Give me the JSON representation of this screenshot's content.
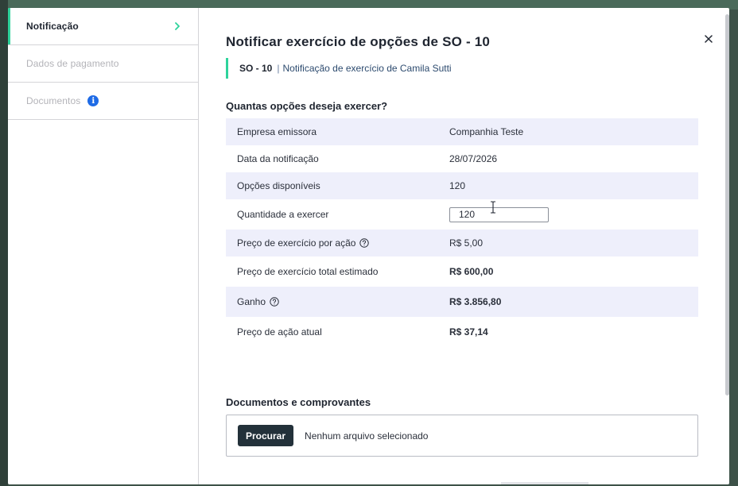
{
  "sidebar": {
    "items": [
      {
        "label": "Notificação",
        "active": true,
        "icon": "chevron-right-icon"
      },
      {
        "label": "Dados de pagamento",
        "active": false
      },
      {
        "label": "Documentos",
        "active": false,
        "icon": "info-icon",
        "icon_glyph": "i"
      }
    ]
  },
  "header": {
    "title": "Notificar exercício de opções de SO - 10",
    "code": "SO - 10",
    "separator": "|",
    "description": "Notificação de exercício de Camila Sutti",
    "close_icon": "close-icon"
  },
  "exercise": {
    "section_title": "Quantas opções deseja exercer?",
    "rows": [
      {
        "label": "Empresa emissora",
        "value": "Companhia Teste"
      },
      {
        "label": "Data da notificação",
        "value": "28/07/2026"
      },
      {
        "label": "Opções disponíveis",
        "value": "120"
      },
      {
        "label": "Quantidade a exercer",
        "input_value": "120"
      },
      {
        "label": "Preço de exercício por ação",
        "value": "R$ 5,00",
        "help_icon": "help-circle-icon"
      },
      {
        "label": "Preço de exercício total estimado",
        "value": "R$ 600,00"
      },
      {
        "label": "Ganho",
        "value": "R$ 3.856,80",
        "help_icon": "help-circle-icon"
      },
      {
        "label": "Preço de ação atual",
        "value": "R$ 37,14"
      }
    ]
  },
  "documents": {
    "section_title": "Documentos e comprovantes",
    "button_label": "Procurar",
    "status": "Nenhum arquivo selecionado"
  },
  "colors": {
    "accent": "#2ed39b",
    "stripe": "#eeeffb",
    "button": "#23313a",
    "info": "#1e6be6"
  }
}
